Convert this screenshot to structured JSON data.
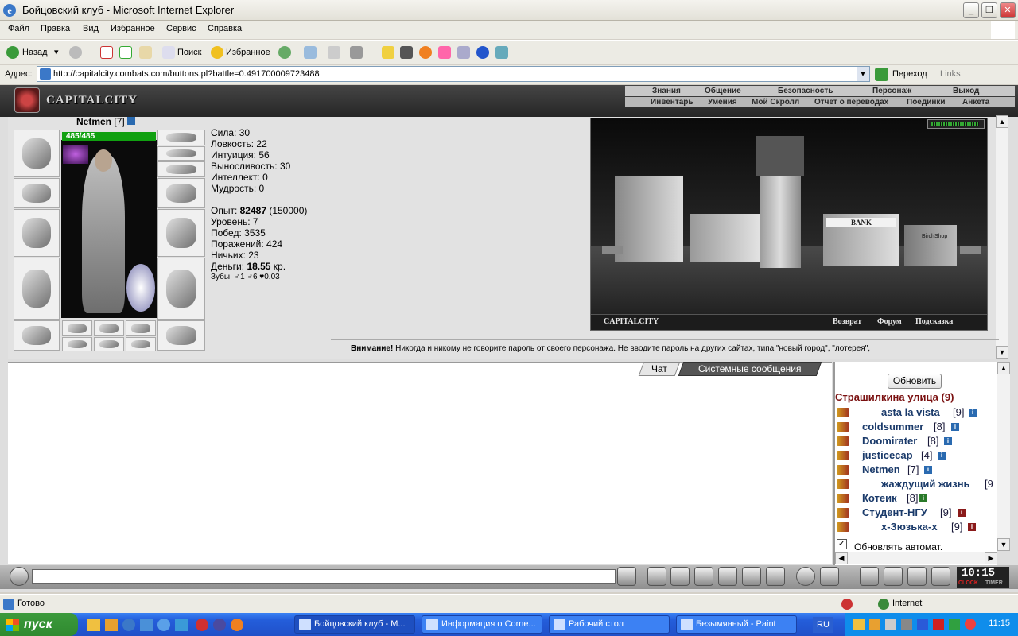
{
  "window": {
    "title": "Бойцовский клуб - Microsoft Internet Explorer"
  },
  "menu": [
    "Файл",
    "Правка",
    "Вид",
    "Избранное",
    "Сервис",
    "Справка"
  ],
  "toolbar": {
    "back": "Назад",
    "search": "Поиск",
    "favorites": "Избранное"
  },
  "address": {
    "label": "Адрес:",
    "url": "http://capitalcity.combats.com/buttons.pl?battle=0.491700009723488",
    "go": "Переход",
    "links": "Links"
  },
  "site": {
    "logo": "CAPITALCITY",
    "nav_top": [
      "Знания",
      "Общение",
      "Безопасность",
      "Персонаж",
      "Выход"
    ],
    "nav_bottom": [
      "Инвентарь",
      "Умения",
      "Мой Скролл",
      "Отчет о переводах",
      "Поединки",
      "Анкета"
    ]
  },
  "character": {
    "name": "Netmen",
    "level": "[7]",
    "hp": "485/485",
    "hp_fraction": 1.0,
    "stats": [
      "Сила: 30",
      "Ловкость: 22",
      "Интуиция: 56",
      "Выносливость: 30",
      "Интеллект: 0",
      "Мудрость: 0"
    ],
    "exp_label": "Опыт: ",
    "exp": "82487",
    "exp_next": " (150000)",
    "info": [
      "Уровень: 7",
      "Побед: 3535",
      "Поражений: 424",
      "Ничьих: 23"
    ],
    "money_label": "Деньги: ",
    "money": "18.55",
    "money_unit": " кр.",
    "teeth": "Зубы: ♂1 ♂6 ♥0.03"
  },
  "scene": {
    "city": "CAPITALCITY",
    "links": [
      "Возврат",
      "Форум",
      "Подсказка"
    ],
    "bank": "BANK",
    "shop": "BirchShop"
  },
  "warning": {
    "bold": "Внимание!",
    "text": " Никогда и никому не говорите пароль от своего персонажа. Не вводите пароль на других сайтах, типа \"новый город\", \"лотерея\","
  },
  "chat": {
    "tab_chat": "Чат",
    "tab_system": "Системные сообщения"
  },
  "users": {
    "refresh": "Обновить",
    "location": "Страшилкина улица (9)",
    "list": [
      {
        "name": "asta la vista",
        "level": "[9]"
      },
      {
        "name": "coldsummer",
        "level": "[8]"
      },
      {
        "name": "Doomirater",
        "level": "[8]"
      },
      {
        "name": "justicecap",
        "level": "[4]"
      },
      {
        "name": "Netmen",
        "level": "[7]"
      },
      {
        "name": "жаждущий жизнь",
        "level": "[9"
      },
      {
        "name": "Котеик",
        "level": "[8]"
      },
      {
        "name": "Студент-НГУ",
        "level": "[9]"
      },
      {
        "name": "x-Зюзька-x",
        "level": "[9]"
      }
    ],
    "auto_refresh": "Обновлять автомат."
  },
  "clock": {
    "time": "10:15",
    "clock_label": "CLOCK",
    "timer_label": "TIMER"
  },
  "status": {
    "text": "Готово",
    "zone": "Internet"
  },
  "taskbar": {
    "start": "пуск",
    "tasks": [
      "Бойцовский клуб - М...",
      "Информация о Corne...",
      "Рабочий стол",
      "Безымянный - Paint"
    ],
    "lang": "RU",
    "time": "11:15"
  }
}
